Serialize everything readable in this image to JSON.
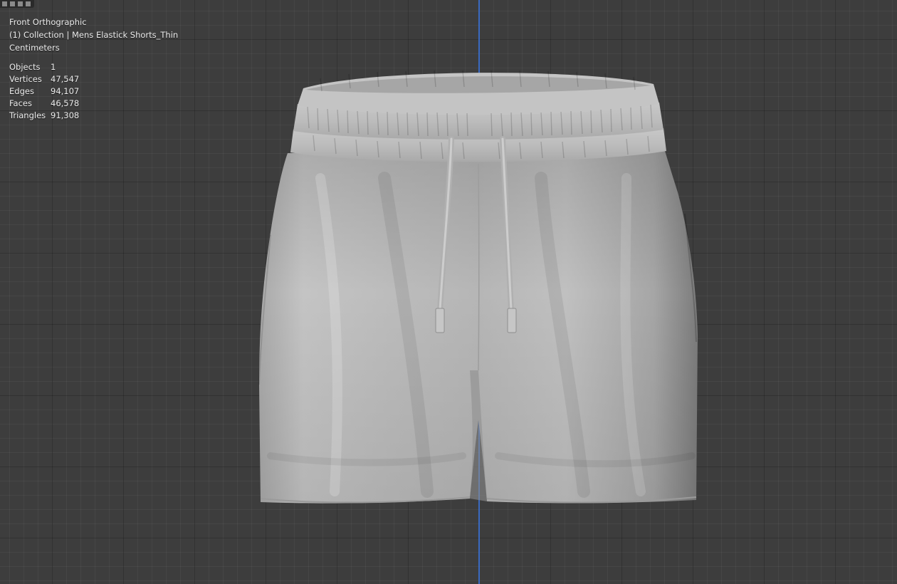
{
  "viewport": {
    "view_name": "Front Orthographic",
    "collection_line": "(1) Collection | Mens  Elastick Shorts_Thin",
    "units": "Centimeters",
    "stats": [
      {
        "label": "Objects",
        "value": "1"
      },
      {
        "label": "Vertices",
        "value": "47,547"
      },
      {
        "label": "Edges",
        "value": "94,107"
      },
      {
        "label": "Faces",
        "value": "46,578"
      },
      {
        "label": "Triangles",
        "value": "91,308"
      }
    ]
  },
  "object": {
    "name": "Mens  Elastick Shorts_Thin",
    "icon": "shorts-mesh-icon"
  },
  "colors": {
    "background": "#3d3d3d",
    "z_axis": "#3a6fcf",
    "mesh": "#b9b9b9"
  }
}
